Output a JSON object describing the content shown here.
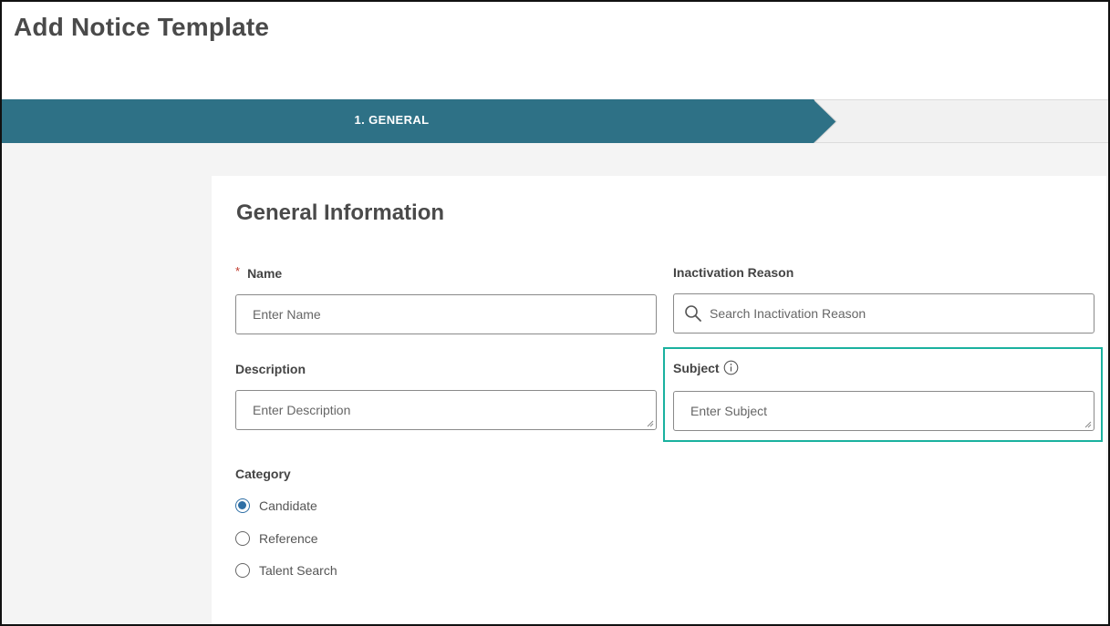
{
  "page": {
    "title": "Add Notice Template"
  },
  "stepper": {
    "active_step": "1. GENERAL",
    "active_color": "#2e7186"
  },
  "form": {
    "section_title": "General Information",
    "name": {
      "label": "Name",
      "required_mark": "*",
      "placeholder": "Enter Name"
    },
    "inactivation_reason": {
      "label": "Inactivation Reason",
      "placeholder": "Search Inactivation Reason",
      "icon": "search-icon"
    },
    "description": {
      "label": "Description",
      "placeholder": "Enter Description"
    },
    "subject": {
      "label": "Subject",
      "placeholder": "Enter Subject",
      "icon": "info-icon",
      "highlight_color": "#1ab19f"
    },
    "category": {
      "label": "Category",
      "options": [
        {
          "label": "Candidate",
          "selected": true
        },
        {
          "label": "Reference",
          "selected": false
        },
        {
          "label": "Talent Search",
          "selected": false
        }
      ]
    }
  }
}
